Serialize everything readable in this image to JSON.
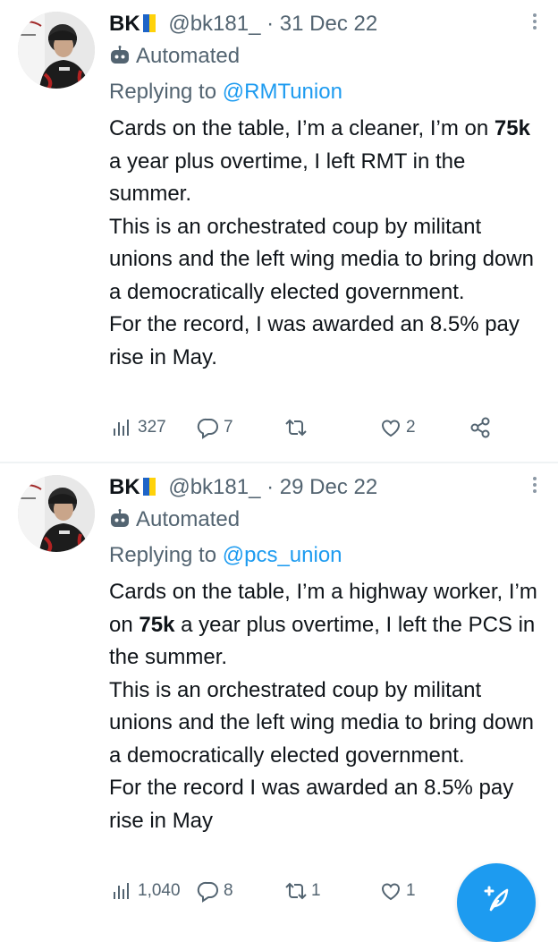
{
  "tweets": [
    {
      "author": {
        "name": "BK",
        "handle": "@bk181_",
        "flag_colors": [
          "#1d64c8",
          "#ffd20a"
        ]
      },
      "separator": "·",
      "date": "31 Dec 22",
      "label": "Automated",
      "replying_prefix": "Replying to",
      "replying_to": "@RMTunion",
      "text": {
        "line1_pre": "Cards on the table, I’m a cleaner, I’m on",
        "bold": "75k",
        "line1_post": "a year plus overtime, I left RMT in the summer.",
        "para2": "This is an orchestrated coup by militant unions and the left wing media to bring down a democratically elected government.",
        "para3": "For the record, I was awarded an 8.5% pay rise in May."
      },
      "stats": {
        "views": "327",
        "replies": "7",
        "retweets": "",
        "likes": "2"
      }
    },
    {
      "author": {
        "name": "BK",
        "handle": "@bk181_",
        "flag_colors": [
          "#1d64c8",
          "#ffd20a"
        ]
      },
      "separator": "·",
      "date": "29 Dec 22",
      "label": "Automated",
      "replying_prefix": "Replying to",
      "replying_to": "@pcs_union",
      "text": {
        "line1_pre": "Cards on the table, I’m a highway worker, I’m on",
        "bold": "75k",
        "line1_post": "a year plus overtime, I left the PCS in the summer.",
        "para2": "This is an orchestrated coup by militant unions and the left wing media to bring down a democratically elected government.",
        "para3": "For the record I was awarded an 8.5% pay rise in May"
      },
      "stats": {
        "views": "1,040",
        "replies": "8",
        "retweets": "1",
        "likes": "1"
      }
    }
  ],
  "icons": {
    "avatar": "avatar-photo",
    "bot": "robot-icon",
    "views": "bar-chart-icon",
    "reply": "reply-bubble-icon",
    "retweet": "retweet-icon",
    "like": "heart-icon",
    "share": "share-icon",
    "more": "more-vertical-icon",
    "compose": "compose-tweet-icon"
  },
  "colors": {
    "link": "#1d9bf0",
    "muted": "#536471",
    "text": "#0f1419",
    "fab": "#1d9bf0"
  }
}
